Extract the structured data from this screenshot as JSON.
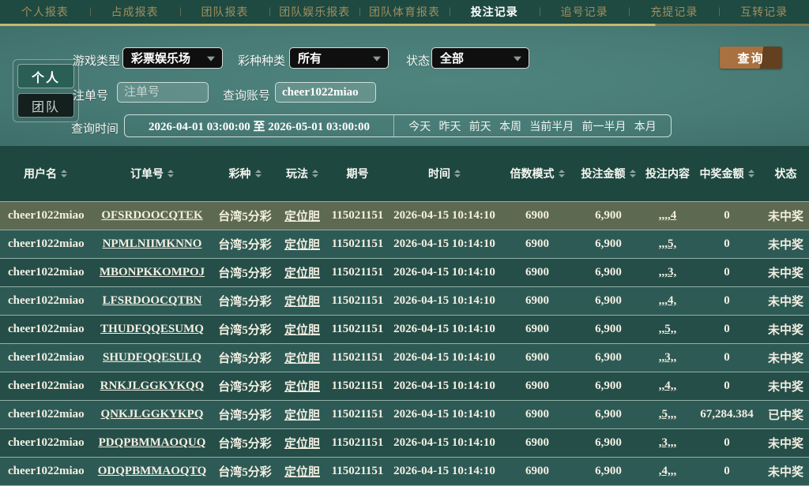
{
  "colors": {
    "accent_gold": "#cbb76b",
    "nav_green": "#1e4a41",
    "panel_teal": "#4a7e79",
    "table_green": "#1d473f",
    "row_highlight": "#5d6950",
    "row_dark": "#254e48",
    "row_light": "#2e5a55",
    "button_copper": "#a9713f",
    "dropdown_black": "#0e0f0e"
  },
  "nav": {
    "tabs": [
      {
        "label": "个人报表"
      },
      {
        "label": "占成报表"
      },
      {
        "label": "团队报表"
      },
      {
        "label": "团队娱乐报表"
      },
      {
        "label": "团队体育报表"
      },
      {
        "label": "投注记录",
        "variant": "active"
      },
      {
        "label": "追号记录"
      },
      {
        "label": "充提记录"
      },
      {
        "label": "互转记录"
      }
    ]
  },
  "filters": {
    "scope_personal": "个人",
    "scope_team": "团队",
    "game_type_label": "游戏类型",
    "game_type_value": "彩票娱乐场",
    "lottery_category_label": "彩种种类",
    "lottery_category_value": "所有",
    "status_label": "状态",
    "status_value": "全部",
    "search_button": "查询",
    "order_no_label": "注单号",
    "order_no_placeholder": "注单号",
    "account_label": "查询账号",
    "account_value": "cheer1022miao",
    "time_label": "查询时间",
    "time_range": "2026-04-01 03:00:00 至 2026-05-01 03:00:00",
    "quick_ranges": [
      "今天",
      "昨天",
      "前天",
      "本周",
      "当前半月",
      "前一半月",
      "本月"
    ]
  },
  "table": {
    "columns": [
      {
        "label": "用户名",
        "variant": "sortable"
      },
      {
        "label": "订单号",
        "variant": "sortable"
      },
      {
        "label": "彩种",
        "variant": "sortable"
      },
      {
        "label": "玩法",
        "variant": "sortable"
      },
      {
        "label": "期号"
      },
      {
        "label": "时间",
        "variant": "sortable"
      },
      {
        "label": "倍数模式",
        "variant": "sortable"
      },
      {
        "label": "投注金额",
        "variant": "sortable"
      },
      {
        "label": "投注内容"
      },
      {
        "label": "中奖金额",
        "variant": "sortable"
      },
      {
        "label": "状态"
      }
    ],
    "rows": [
      {
        "username": "cheer1022miao",
        "order_no": "OFSRDOOCQTEK",
        "lottery": "台湾5分彩",
        "play": "定位胆",
        "issue": "115021151",
        "time": "2026-04-15 10:14:10",
        "multiplier": "6900",
        "amount": "6,900",
        "content": ",,,,4",
        "win": "0",
        "status": "未中奖",
        "variant": "highlight"
      },
      {
        "username": "cheer1022miao",
        "order_no": "NPMLNIIMKNNO",
        "lottery": "台湾5分彩",
        "play": "定位胆",
        "issue": "115021151",
        "time": "2026-04-15 10:14:10",
        "multiplier": "6900",
        "amount": "6,900",
        "content": ",,,5,",
        "win": "0",
        "status": "未中奖",
        "variant": "light"
      },
      {
        "username": "cheer1022miao",
        "order_no": "MBONPKKOMPOJ",
        "lottery": "台湾5分彩",
        "play": "定位胆",
        "issue": "115021151",
        "time": "2026-04-15 10:14:10",
        "multiplier": "6900",
        "amount": "6,900",
        "content": ",,,3,",
        "win": "0",
        "status": "未中奖",
        "variant": "dark"
      },
      {
        "username": "cheer1022miao",
        "order_no": "LFSRDOOCQTBN",
        "lottery": "台湾5分彩",
        "play": "定位胆",
        "issue": "115021151",
        "time": "2026-04-15 10:14:10",
        "multiplier": "6900",
        "amount": "6,900",
        "content": ",,,4,",
        "win": "0",
        "status": "未中奖",
        "variant": "light"
      },
      {
        "username": "cheer1022miao",
        "order_no": "THUDFQQESUMQ",
        "lottery": "台湾5分彩",
        "play": "定位胆",
        "issue": "115021151",
        "time": "2026-04-15 10:14:10",
        "multiplier": "6900",
        "amount": "6,900",
        "content": ",,5,,",
        "win": "0",
        "status": "未中奖",
        "variant": "dark"
      },
      {
        "username": "cheer1022miao",
        "order_no": "SHUDFQQESULQ",
        "lottery": "台湾5分彩",
        "play": "定位胆",
        "issue": "115021151",
        "time": "2026-04-15 10:14:10",
        "multiplier": "6900",
        "amount": "6,900",
        "content": ",,3,,",
        "win": "0",
        "status": "未中奖",
        "variant": "light"
      },
      {
        "username": "cheer1022miao",
        "order_no": "RNKJLGGKYKQQ",
        "lottery": "台湾5分彩",
        "play": "定位胆",
        "issue": "115021151",
        "time": "2026-04-15 10:14:10",
        "multiplier": "6900",
        "amount": "6,900",
        "content": ",,4,,",
        "win": "0",
        "status": "未中奖",
        "variant": "dark"
      },
      {
        "username": "cheer1022miao",
        "order_no": "QNKJLGGKYKPQ",
        "lottery": "台湾5分彩",
        "play": "定位胆",
        "issue": "115021151",
        "time": "2026-04-15 10:14:10",
        "multiplier": "6900",
        "amount": "6,900",
        "content": ",5,,,",
        "win": "67,284.384",
        "status": "已中奖",
        "variant": "light"
      },
      {
        "username": "cheer1022miao",
        "order_no": "PDQPBMMAOQUQ",
        "lottery": "台湾5分彩",
        "play": "定位胆",
        "issue": "115021151",
        "time": "2026-04-15 10:14:10",
        "multiplier": "6900",
        "amount": "6,900",
        "content": ",3,,,",
        "win": "0",
        "status": "未中奖",
        "variant": "dark"
      },
      {
        "username": "cheer1022miao",
        "order_no": "ODQPBMMAOQTQ",
        "lottery": "台湾5分彩",
        "play": "定位胆",
        "issue": "115021151",
        "time": "2026-04-15 10:14:10",
        "multiplier": "6900",
        "amount": "6,900",
        "content": ",4,,,",
        "win": "0",
        "status": "未中奖",
        "variant": "light"
      }
    ]
  }
}
